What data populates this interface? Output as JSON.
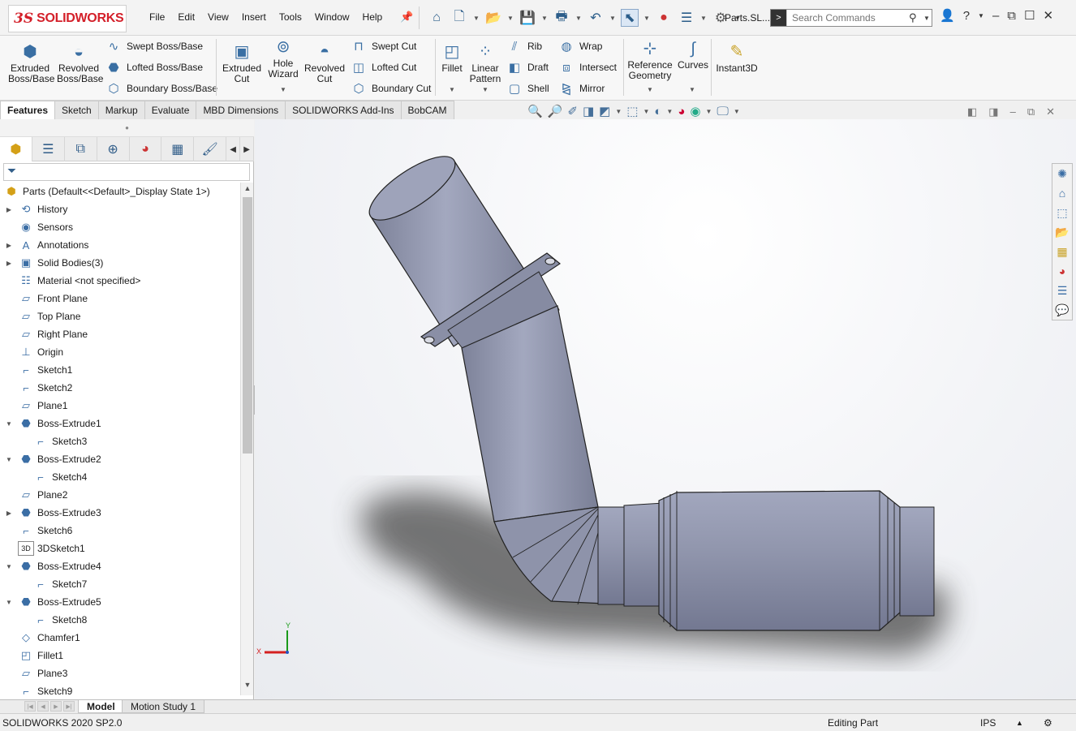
{
  "app": {
    "logo_ds": "3S",
    "logo_text": "SOLIDWORKS",
    "doc_title": "Parts.SL..."
  },
  "menu": [
    "File",
    "Edit",
    "View",
    "Insert",
    "Tools",
    "Window",
    "Help"
  ],
  "search": {
    "placeholder": "Search Commands"
  },
  "ribbon": {
    "extruded_boss": "Extruded\nBoss/Base",
    "revolved_boss": "Revolved\nBoss/Base",
    "swept_boss": "Swept Boss/Base",
    "lofted_boss": "Lofted Boss/Base",
    "boundary_boss": "Boundary Boss/Base",
    "extruded_cut": "Extruded\nCut",
    "hole_wizard": "Hole\nWizard",
    "revolved_cut": "Revolved\nCut",
    "swept_cut": "Swept Cut",
    "lofted_cut": "Lofted Cut",
    "boundary_cut": "Boundary Cut",
    "fillet": "Fillet",
    "linear_pattern": "Linear\nPattern",
    "rib": "Rib",
    "draft": "Draft",
    "shell": "Shell",
    "wrap": "Wrap",
    "intersect": "Intersect",
    "mirror": "Mirror",
    "reference_geometry": "Reference\nGeometry",
    "curves": "Curves",
    "instant3d": "Instant3D"
  },
  "tabs": [
    "Features",
    "Sketch",
    "Markup",
    "Evaluate",
    "MBD Dimensions",
    "SOLIDWORKS Add-Ins",
    "BobCAM"
  ],
  "tree": [
    {
      "label": "Parts  (Default<<Default>_Display State 1>)",
      "icon": "part-icon",
      "exp": "",
      "indent": 0
    },
    {
      "label": "History",
      "icon": "history-icon",
      "exp": "▶",
      "indent": 1
    },
    {
      "label": "Sensors",
      "icon": "sensor-icon",
      "exp": "",
      "indent": 1
    },
    {
      "label": "Annotations",
      "icon": "annotation-icon",
      "exp": "▶",
      "indent": 1
    },
    {
      "label": "Solid Bodies(3)",
      "icon": "solid-bodies-icon",
      "exp": "▶",
      "indent": 1
    },
    {
      "label": "Material <not specified>",
      "icon": "material-icon",
      "exp": "",
      "indent": 1
    },
    {
      "label": "Front Plane",
      "icon": "plane-icon",
      "exp": "",
      "indent": 1
    },
    {
      "label": "Top Plane",
      "icon": "plane-icon",
      "exp": "",
      "indent": 1
    },
    {
      "label": "Right Plane",
      "icon": "plane-icon",
      "exp": "",
      "indent": 1
    },
    {
      "label": "Origin",
      "icon": "origin-icon",
      "exp": "",
      "indent": 1
    },
    {
      "label": "Sketch1",
      "icon": "sketch-icon",
      "exp": "",
      "indent": 1
    },
    {
      "label": "Sketch2",
      "icon": "sketch-icon",
      "exp": "",
      "indent": 1
    },
    {
      "label": "Plane1",
      "icon": "plane-icon",
      "exp": "",
      "indent": 1
    },
    {
      "label": "Boss-Extrude1",
      "icon": "extrude-icon",
      "exp": "▼",
      "indent": 1
    },
    {
      "label": "Sketch3",
      "icon": "sketch-icon",
      "exp": "",
      "indent": 2
    },
    {
      "label": "Boss-Extrude2",
      "icon": "extrude-icon",
      "exp": "▼",
      "indent": 1
    },
    {
      "label": "Sketch4",
      "icon": "sketch-icon",
      "exp": "",
      "indent": 2
    },
    {
      "label": "Plane2",
      "icon": "plane-icon",
      "exp": "",
      "indent": 1
    },
    {
      "label": "Boss-Extrude3",
      "icon": "extrude-icon",
      "exp": "▶",
      "indent": 1
    },
    {
      "label": "Sketch6",
      "icon": "sketch-icon",
      "exp": "",
      "indent": 1
    },
    {
      "label": "3DSketch1",
      "icon": "3dsketch-icon",
      "exp": "",
      "indent": 1
    },
    {
      "label": "Boss-Extrude4",
      "icon": "extrude-icon",
      "exp": "▼",
      "indent": 1
    },
    {
      "label": "Sketch7",
      "icon": "sketch-icon",
      "exp": "",
      "indent": 2
    },
    {
      "label": "Boss-Extrude5",
      "icon": "extrude-icon",
      "exp": "▼",
      "indent": 1
    },
    {
      "label": "Sketch8",
      "icon": "sketch-icon",
      "exp": "",
      "indent": 2
    },
    {
      "label": "Chamfer1",
      "icon": "chamfer-icon",
      "exp": "",
      "indent": 1
    },
    {
      "label": "Fillet1",
      "icon": "fillet-icon",
      "exp": "",
      "indent": 1
    },
    {
      "label": "Plane3",
      "icon": "plane-icon",
      "exp": "",
      "indent": 1
    },
    {
      "label": "Sketch9",
      "icon": "sketch-icon",
      "exp": "",
      "indent": 1
    }
  ],
  "bottom_tabs": [
    "Model",
    "Motion Study 1"
  ],
  "triad": {
    "x": "X",
    "y": "Y"
  },
  "status": {
    "version": "SOLIDWORKS 2020 SP2.0",
    "mode": "Editing Part",
    "units": "IPS"
  },
  "colors": {
    "brand_red": "#d4202a",
    "part_body": "#9196ae",
    "icon_blue": "#3b6ea5"
  }
}
